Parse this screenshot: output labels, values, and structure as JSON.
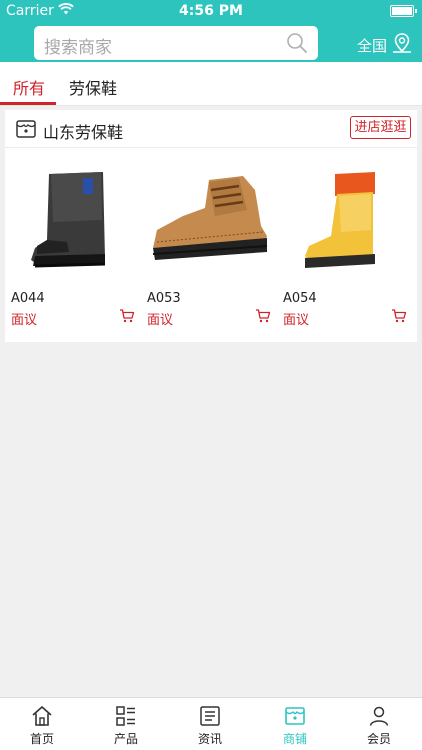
{
  "status_bar": {
    "carrier": "Carrier",
    "time": "4:56 PM"
  },
  "search": {
    "placeholder": "搜索商家"
  },
  "region": {
    "label": "全国"
  },
  "tabs": [
    {
      "label": "所有",
      "active": true
    },
    {
      "label": "劳保鞋",
      "active": false
    }
  ],
  "shop": {
    "name": "山东劳保鞋",
    "enter_label": "进店逛逛",
    "products": [
      {
        "code": "A044",
        "price": "面议",
        "image": "black-rigger-boot"
      },
      {
        "code": "A053",
        "price": "面议",
        "image": "brown-suede-safety-shoe"
      },
      {
        "code": "A054",
        "price": "面议",
        "image": "yellow-rain-boot"
      }
    ]
  },
  "tabbar": [
    {
      "label": "首页",
      "icon": "home-icon",
      "active": false
    },
    {
      "label": "产品",
      "icon": "grid-list-icon",
      "active": false
    },
    {
      "label": "资讯",
      "icon": "news-icon",
      "active": false
    },
    {
      "label": "商铺",
      "icon": "store-icon",
      "active": true
    },
    {
      "label": "会员",
      "icon": "user-icon",
      "active": false
    }
  ],
  "colors": {
    "brand": "#2ec4be",
    "accent": "#d0242b"
  }
}
